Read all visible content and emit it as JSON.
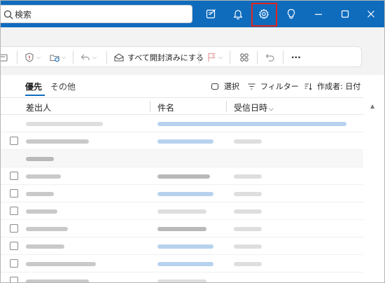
{
  "search": {
    "placeholder_text": "検索",
    "icon": "search-icon"
  },
  "titlebar": {
    "icons": [
      "compose-icon",
      "bell-icon",
      "gear-icon",
      "lightbulb-icon",
      "minimize-icon",
      "maximize-icon",
      "close-icon"
    ],
    "accent": "#0f6cbd",
    "highlight_color": "#e0261e"
  },
  "ribbon": {
    "mark_all_read_label": "すべて開封済みにする",
    "more_label": "···"
  },
  "filterbar": {
    "tab_focused": "優先",
    "tab_other": "その他",
    "select_label": "選択",
    "filter_label": "フィルター",
    "sort_label": "作成者: 日付"
  },
  "columns": {
    "sender": "差出人",
    "subject": "件名",
    "received": "受信日時",
    "received_caret": "⌵"
  },
  "list": {
    "rows_note_visible": "blurred email rows"
  }
}
